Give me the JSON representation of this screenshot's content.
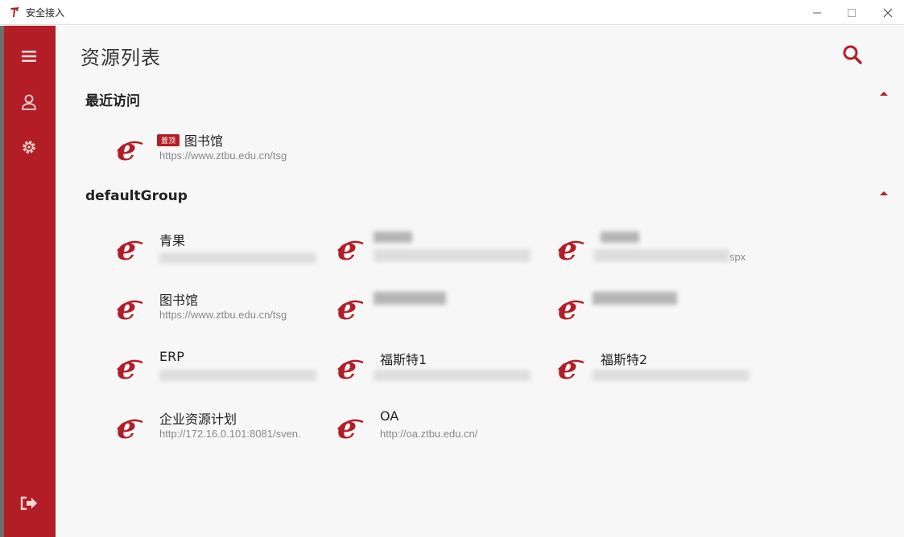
{
  "window": {
    "title": "安全接入",
    "min_icon": "minimize-icon",
    "max_icon": "maximize-icon",
    "close_icon": "close-icon"
  },
  "colors": {
    "brand": "#b31d26",
    "background": "#f7f7f7"
  },
  "sidebar": {
    "items": [
      {
        "icon": "menu-icon"
      },
      {
        "icon": "user-icon"
      },
      {
        "icon": "gear-icon"
      }
    ],
    "bottom_item": {
      "icon": "logout-icon"
    }
  },
  "main": {
    "title": "资源列表",
    "search_icon": "search-icon",
    "groups": [
      {
        "title": "最近访问",
        "items": [
          {
            "pinned_label": "置顶",
            "name": "图书馆",
            "url": "https://www.ztbu.edu.cn/tsg"
          }
        ]
      },
      {
        "title": "defaultGroup",
        "items": [
          {
            "name": "青果",
            "url": ""
          },
          {
            "name": "",
            "url": ""
          },
          {
            "name": "",
            "url": "spx"
          },
          {
            "name": "图书馆",
            "url": "https://www.ztbu.edu.cn/tsg"
          },
          {
            "name": "",
            "url": ""
          },
          {
            "name": "",
            "url": ""
          },
          {
            "name": "ERP",
            "url": ""
          },
          {
            "name": "福斯特1",
            "url": ""
          },
          {
            "name": "福斯特2",
            "url": ""
          },
          {
            "name": "企业资源计划",
            "url": "http://172.16.0.101:8081/sven."
          },
          {
            "name": "OA",
            "url": "http://oa.ztbu.edu.cn/"
          }
        ]
      }
    ]
  }
}
